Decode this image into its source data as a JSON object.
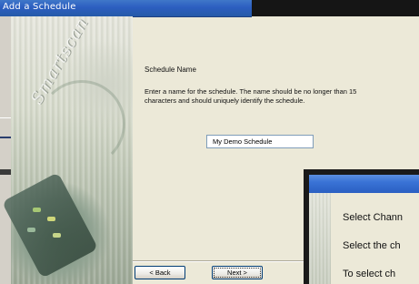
{
  "window": {
    "title": "Add a Schedule"
  },
  "content": {
    "heading": "Schedule Name",
    "description": "Enter a name for the schedule. The name should be no longer than 15 characters and should uniquely identify the schedule.",
    "name_input_value": "My Demo Schedule"
  },
  "buttons": {
    "back_label": "< Back",
    "next_label": "Next >"
  },
  "second_dialog": {
    "line1": "Select Chann",
    "line2": "Select the ch",
    "line3": "To select ch"
  },
  "colors": {
    "titlebar": "#2c5ec0",
    "dialog_bg": "#ece9d8",
    "input_border": "#7f9db9"
  }
}
